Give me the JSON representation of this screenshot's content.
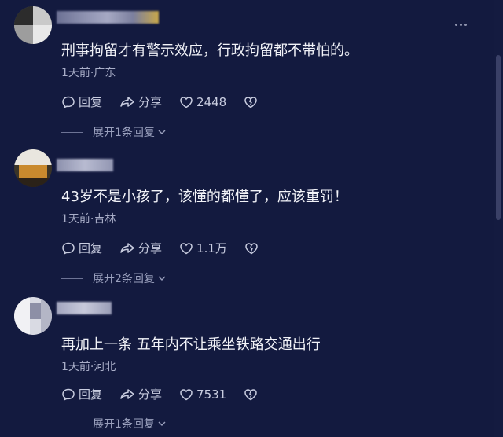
{
  "comments": [
    {
      "content": "刑事拘留才有警示效应，行政拘留都不带怕的。",
      "meta": "1天前·广东",
      "reply_label": "回复",
      "share_label": "分享",
      "likes": "2448",
      "expand_replies": "展开1条回复"
    },
    {
      "content": "43岁不是小孩了，该懂的都懂了，应该重罚！",
      "meta": "1天前·吉林",
      "reply_label": "回复",
      "share_label": "分享",
      "likes": "1.1万",
      "expand_replies": "展开2条回复"
    },
    {
      "content": "再加上一条 五年内不让乘坐铁路交通出行",
      "meta": "1天前·河北",
      "reply_label": "回复",
      "share_label": "分享",
      "likes": "7531",
      "expand_replies": "展开1条回复"
    }
  ],
  "icons": {
    "reply": "comment-bubble-icon",
    "share": "share-arrow-icon",
    "like": "heart-icon",
    "dislike": "broken-heart-icon",
    "more": "more-dots-icon",
    "expand": "chevron-down-icon"
  },
  "colors": {
    "background": "#131a3f",
    "text": "#f2f3f8",
    "meta": "#a9aec8"
  }
}
